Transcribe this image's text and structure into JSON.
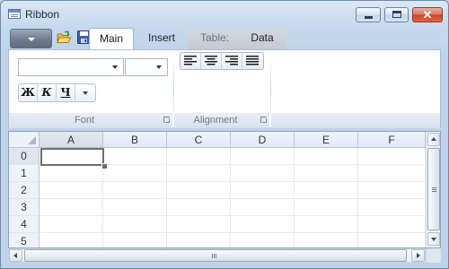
{
  "window": {
    "title": "Ribbon",
    "controls": {
      "close_glyph": "✕"
    },
    "icons": [
      "window-app-icon",
      "minimize-icon",
      "maximize-icon",
      "close-icon"
    ]
  },
  "quick_access": {
    "items": [
      "open-folder-icon",
      "save-icon"
    ]
  },
  "tabs": [
    {
      "label": "Main",
      "selected": true
    },
    {
      "label": "Insert"
    },
    {
      "label": "Table:",
      "contextual": true
    },
    {
      "label": "Data",
      "contextual": true
    }
  ],
  "ribbon": {
    "font_group": {
      "title": "Font",
      "font_family_value": "",
      "font_size_value": "",
      "bold": "Ж",
      "italic": "К",
      "underline": "Ч"
    },
    "alignment_group": {
      "title": "Alignment",
      "buttons": [
        "align-left-icon",
        "align-center-icon",
        "align-right-icon",
        "justify-icon"
      ]
    }
  },
  "grid": {
    "columns": [
      "A",
      "B",
      "C",
      "D",
      "E",
      "F"
    ],
    "rows": [
      "0",
      "1",
      "2",
      "3",
      "4",
      "5"
    ],
    "active_cell": "A0"
  },
  "colors": {
    "accent": "#6b8fc0",
    "window_frame": "#bcd3ea",
    "close_button": "#c84229",
    "contextual_tab": "#c4cad2"
  }
}
